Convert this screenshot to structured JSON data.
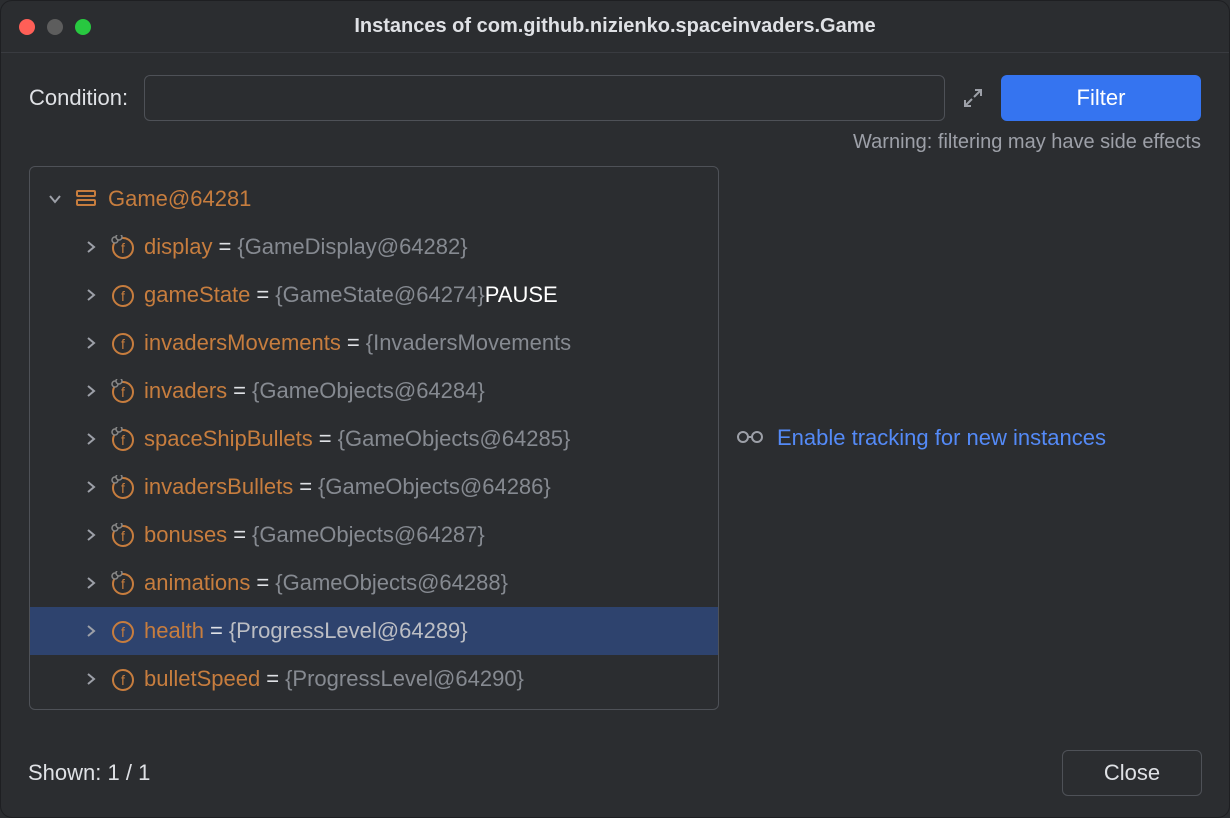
{
  "title": "Instances of com.github.nizienko.spaceinvaders.Game",
  "conditionLabel": "Condition:",
  "conditionValue": "",
  "filterLabel": "Filter",
  "warningText": "Warning: filtering may have side effects",
  "rootNode": {
    "label": "Game@64281"
  },
  "fields": [
    {
      "name": "display",
      "value": "{GameDisplay@64282}",
      "linked": true,
      "selected": false,
      "extra": ""
    },
    {
      "name": "gameState",
      "value": "{GameState@64274}",
      "linked": false,
      "selected": false,
      "extra": "PAUSE"
    },
    {
      "name": "invadersMovements",
      "value": "{InvadersMovements",
      "linked": false,
      "selected": false,
      "extra": ""
    },
    {
      "name": "invaders",
      "value": "{GameObjects@64284}",
      "linked": true,
      "selected": false,
      "extra": ""
    },
    {
      "name": "spaceShipBullets",
      "value": "{GameObjects@64285}",
      "linked": true,
      "selected": false,
      "extra": ""
    },
    {
      "name": "invadersBullets",
      "value": "{GameObjects@64286}",
      "linked": true,
      "selected": false,
      "extra": ""
    },
    {
      "name": "bonuses",
      "value": "{GameObjects@64287}",
      "linked": true,
      "selected": false,
      "extra": ""
    },
    {
      "name": "animations",
      "value": "{GameObjects@64288}",
      "linked": true,
      "selected": false,
      "extra": ""
    },
    {
      "name": "health",
      "value": "{ProgressLevel@64289}",
      "linked": false,
      "selected": true,
      "extra": ""
    },
    {
      "name": "bulletSpeed",
      "value": "{ProgressLevel@64290}",
      "linked": false,
      "selected": false,
      "extra": ""
    }
  ],
  "trackingLink": "Enable tracking for new instances",
  "shownLabel": "Shown: 1 / 1",
  "closeLabel": "Close"
}
